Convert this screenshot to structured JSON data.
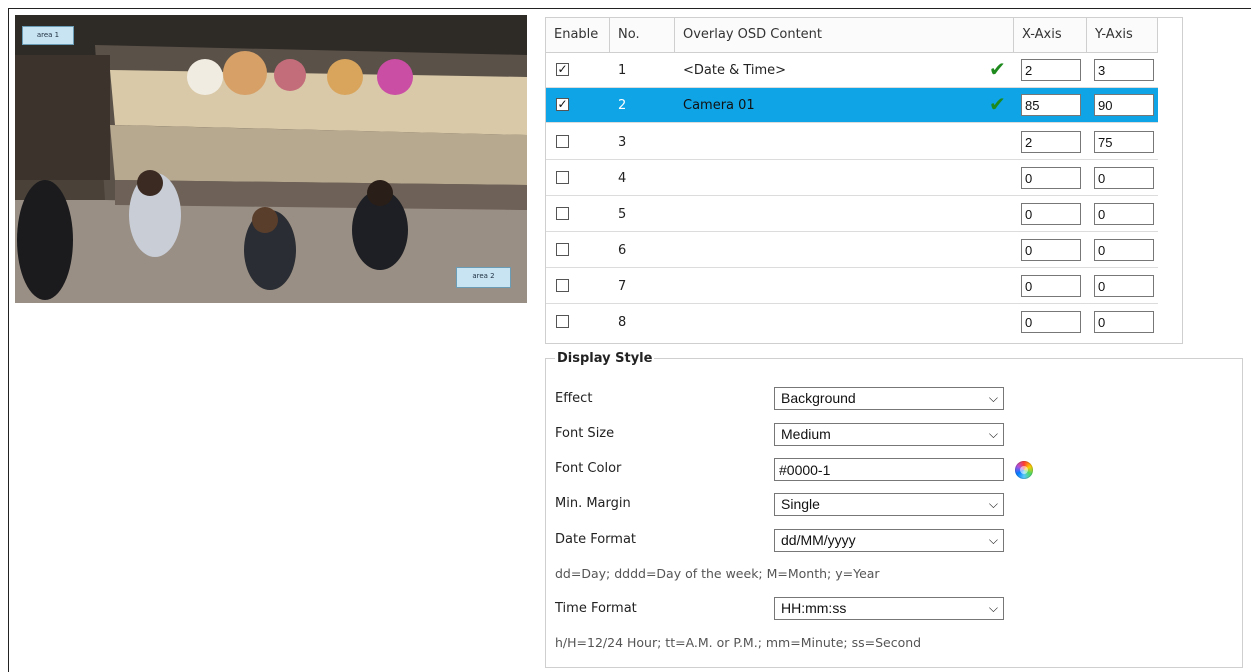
{
  "preview": {
    "area1_label": "area 1",
    "area2_label": "area 2"
  },
  "osd_table": {
    "headers": {
      "enable": "Enable",
      "no": "No.",
      "content": "Overlay OSD Content",
      "x": "X-Axis",
      "y": "Y-Axis"
    },
    "selected_row": 2,
    "rows": [
      {
        "no": "1",
        "enabled": true,
        "content": "<Date & Time>",
        "valid": true,
        "x": "2",
        "y": "3"
      },
      {
        "no": "2",
        "enabled": true,
        "content": "Camera 01",
        "valid": true,
        "x": "85",
        "y": "90"
      },
      {
        "no": "3",
        "enabled": false,
        "content": "",
        "valid": false,
        "x": "2",
        "y": "75"
      },
      {
        "no": "4",
        "enabled": false,
        "content": "",
        "valid": false,
        "x": "0",
        "y": "0"
      },
      {
        "no": "5",
        "enabled": false,
        "content": "",
        "valid": false,
        "x": "0",
        "y": "0"
      },
      {
        "no": "6",
        "enabled": false,
        "content": "",
        "valid": false,
        "x": "0",
        "y": "0"
      },
      {
        "no": "7",
        "enabled": false,
        "content": "",
        "valid": false,
        "x": "0",
        "y": "0"
      },
      {
        "no": "8",
        "enabled": false,
        "content": "",
        "valid": false,
        "x": "0",
        "y": "0"
      }
    ]
  },
  "display_style": {
    "legend": "Display Style",
    "effect_label": "Effect",
    "effect_value": "Background",
    "font_size_label": "Font Size",
    "font_size_value": "Medium",
    "font_color_label": "Font Color",
    "font_color_value": "#0000-1",
    "min_margin_label": "Min. Margin",
    "min_margin_value": "Single",
    "date_format_label": "Date Format",
    "date_format_value": "dd/MM/yyyy",
    "date_hint": "dd=Day; dddd=Day of the week; M=Month; y=Year",
    "time_format_label": "Time Format",
    "time_format_value": "HH:mm:ss",
    "time_hint": "h/H=12/24 Hour; tt=A.M. or P.M.; mm=Minute; ss=Second"
  },
  "colors": {
    "selected_row": "#0fa4e6",
    "valid_check": "#1e8a1e",
    "border": "#cfcfcf"
  },
  "icons": {
    "checkbox_checked": "check-mark",
    "valid": "green-check-icon",
    "dropdown": "chevron-down-icon",
    "color_picker": "color-wheel-icon"
  }
}
